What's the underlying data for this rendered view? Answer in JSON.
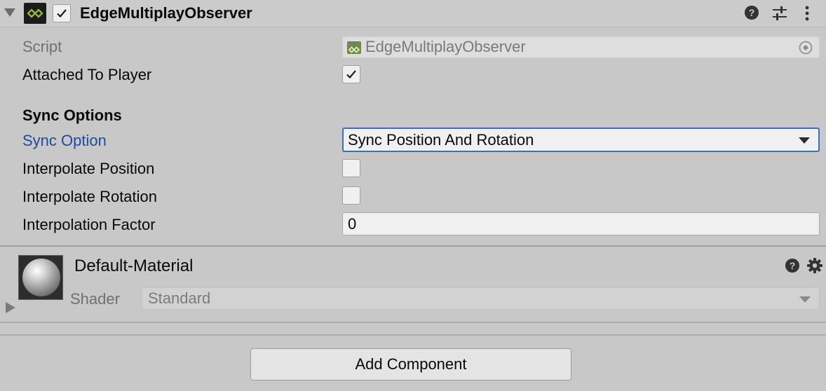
{
  "component": {
    "title": "EdgeMultiplayObserver",
    "enabled": true,
    "icon": "edge-multiplay-script-icon",
    "header_icons": [
      "help-icon",
      "presets-icon",
      "kebab-menu-icon"
    ]
  },
  "properties": {
    "script_label": "Script",
    "script_value": "EdgeMultiplayObserver",
    "attached_label": "Attached To Player",
    "attached_value": true,
    "section_header": "Sync Options",
    "sync_option_label": "Sync Option",
    "sync_option_value": "Sync Position And Rotation",
    "interp_pos_label": "Interpolate Position",
    "interp_pos_value": false,
    "interp_rot_label": "Interpolate Rotation",
    "interp_rot_value": false,
    "interp_factor_label": "Interpolation Factor",
    "interp_factor_value": "0"
  },
  "material": {
    "name": "Default-Material",
    "shader_label": "Shader",
    "shader_value": "Standard",
    "header_icons": [
      "help-icon",
      "gear-icon"
    ]
  },
  "footer": {
    "add_component_label": "Add Component"
  },
  "colors": {
    "background": "#c8c8c8",
    "accent_blue": "#1e4aa3",
    "focus_border": "#3a72b0",
    "icon_green": "#8fb63a"
  }
}
